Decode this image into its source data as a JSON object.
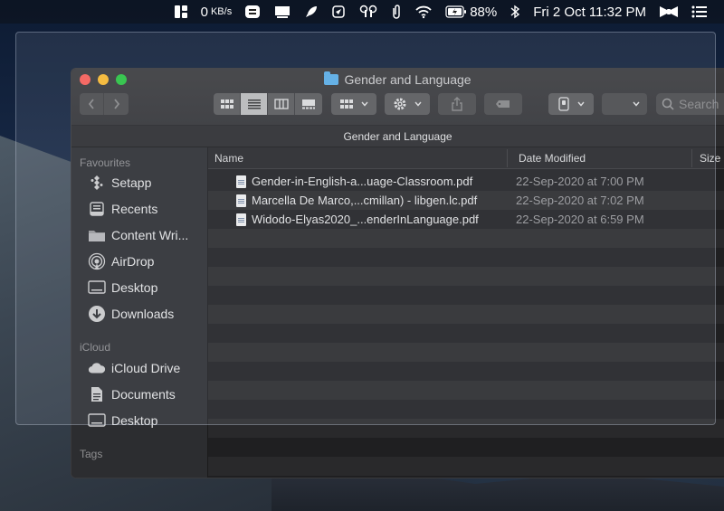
{
  "menubar": {
    "network_speed": "0",
    "network_unit": "KB/s",
    "battery_percent": "88%",
    "datetime": "Fri 2 Oct  11:32 PM"
  },
  "window": {
    "title": "Gender and Language",
    "path_title": "Gender and Language",
    "search_placeholder": "Search"
  },
  "sidebar": {
    "favourites_heading": "Favourites",
    "favourites": [
      {
        "label": "Setapp",
        "icon": "setapp-icon"
      },
      {
        "label": "Recents",
        "icon": "recents-icon"
      },
      {
        "label": "Content Wri...",
        "icon": "folder-icon"
      },
      {
        "label": "AirDrop",
        "icon": "airdrop-icon"
      },
      {
        "label": "Desktop",
        "icon": "desktop-icon"
      },
      {
        "label": "Downloads",
        "icon": "downloads-icon"
      }
    ],
    "icloud_heading": "iCloud",
    "icloud": [
      {
        "label": "iCloud Drive",
        "icon": "cloud-icon"
      },
      {
        "label": "Documents",
        "icon": "documents-icon"
      },
      {
        "label": "Desktop",
        "icon": "desktop-icon"
      }
    ],
    "tags_heading": "Tags"
  },
  "list": {
    "columns": {
      "name": "Name",
      "date": "Date Modified",
      "size": "Size"
    },
    "files": [
      {
        "name": "Gender-in-English-a...uage-Classroom.pdf",
        "date": "22-Sep-2020 at 7:00 PM"
      },
      {
        "name": "Marcella De Marco,...cmillan) - libgen.lc.pdf",
        "date": "22-Sep-2020 at 7:02 PM"
      },
      {
        "name": "Widodo-Elyas2020_...enderInLanguage.pdf",
        "date": "22-Sep-2020 at 6:59 PM"
      }
    ]
  }
}
